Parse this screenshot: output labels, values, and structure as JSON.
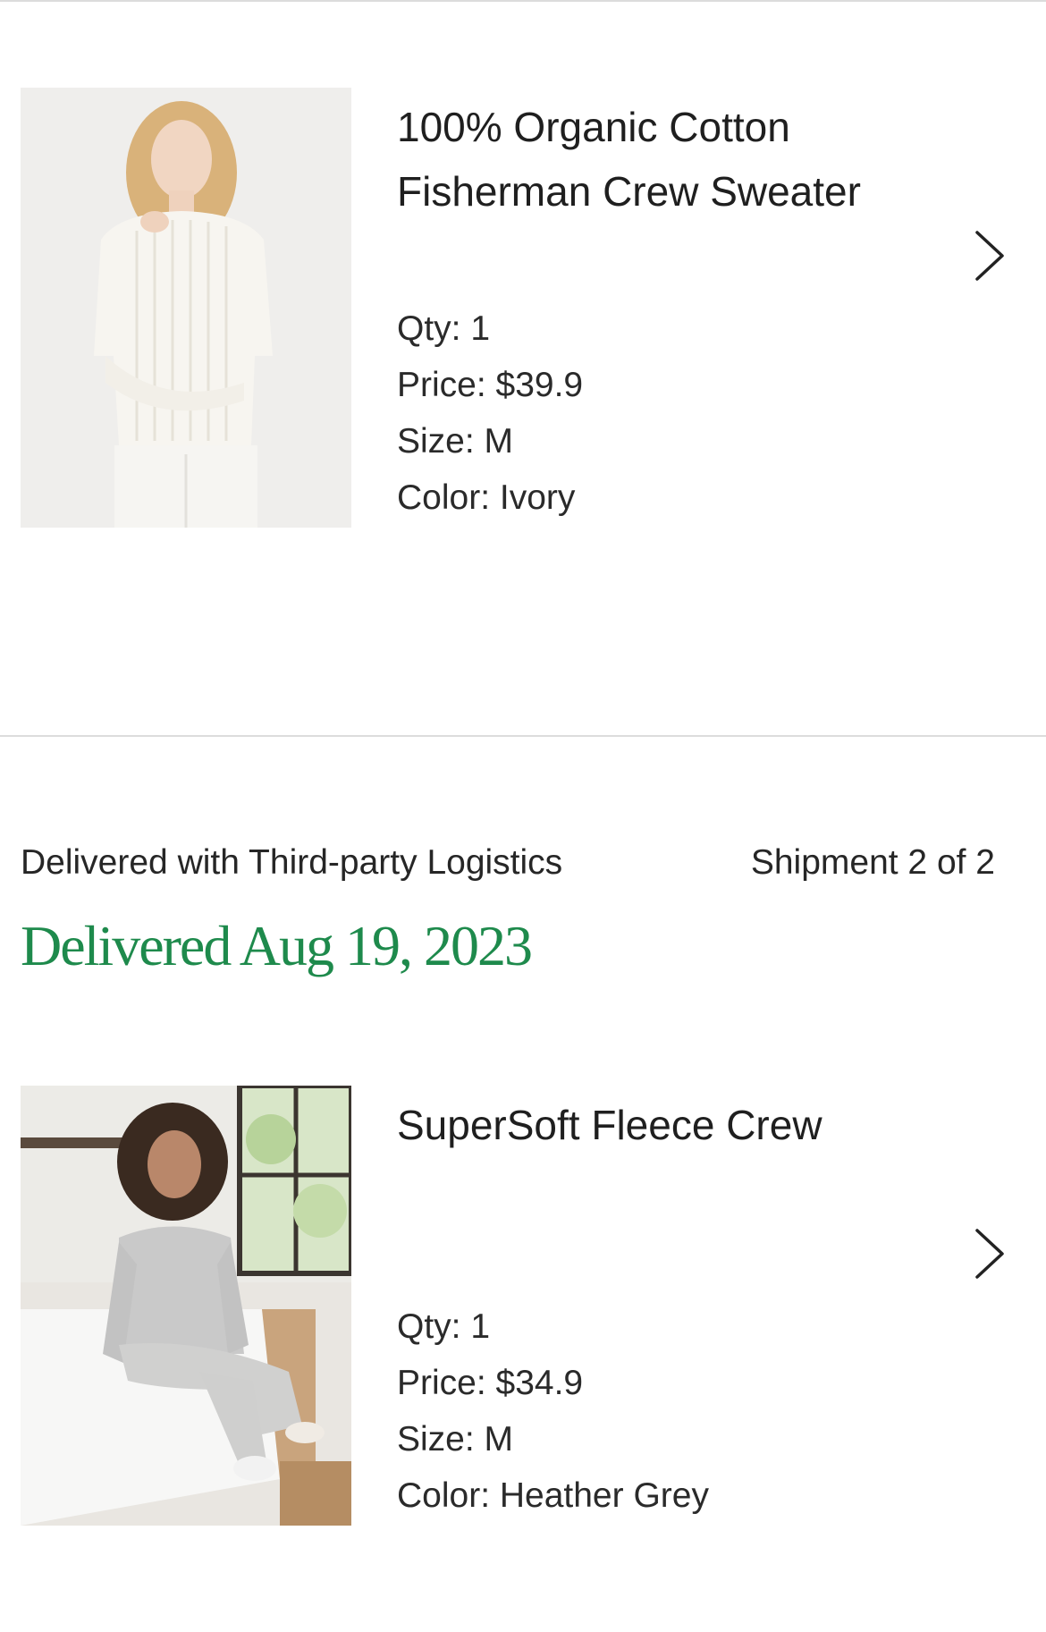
{
  "colors": {
    "accent_green": "#1e8a4c",
    "text": "#1f1f1f",
    "divider": "#dcdcdc"
  },
  "products": [
    {
      "name_lines": [
        "100% Organic Cotton",
        "Fisherman Crew Sweater"
      ],
      "qty": "Qty: 1",
      "price": "Price: $39.9",
      "size": "Size: M",
      "color": "Color: Ivory",
      "image": "ivory-sweater-model-photo",
      "action_icon": "chevron-right-icon"
    },
    {
      "name_lines": [
        "SuperSoft Fleece Crew"
      ],
      "qty": "Qty: 1",
      "price": "Price: $34.9",
      "size": "Size: M",
      "color": "Color: Heather Grey",
      "image": "grey-fleece-model-photo",
      "action_icon": "chevron-right-icon"
    }
  ],
  "shipment": {
    "carrier_text": "Delivered with Third-party Logistics",
    "count_text": "Shipment 2 of 2",
    "status": "Delivered Aug 19, 2023"
  }
}
